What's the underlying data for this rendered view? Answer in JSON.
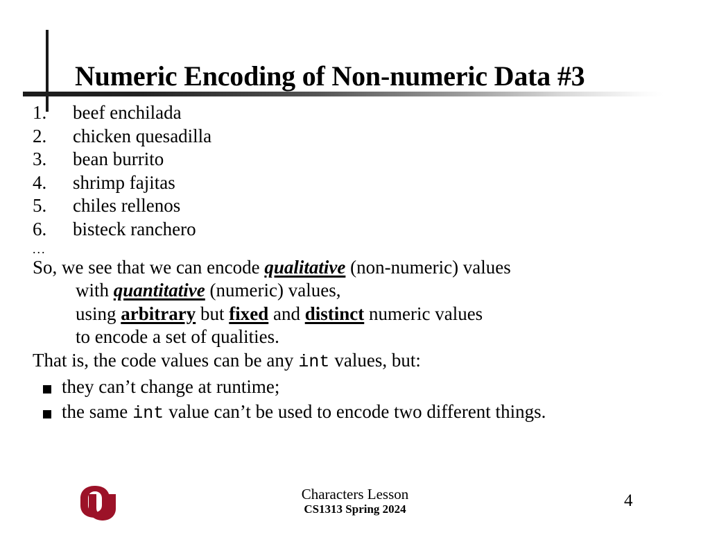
{
  "slide": {
    "title": "Numeric Encoding of Non-numeric Data #3",
    "page_number": "4"
  },
  "food_list": {
    "items": [
      {
        "number": "1.",
        "label": "beef enchilada"
      },
      {
        "number": "2.",
        "label": "chicken quesadilla"
      },
      {
        "number": "3.",
        "label": "bean burrito"
      },
      {
        "number": "4.",
        "label": "shrimp fajitas"
      },
      {
        "number": "5.",
        "label": "chiles rellenos"
      },
      {
        "number": "6.",
        "label": "bisteck ranchero"
      }
    ],
    "continuation": "..."
  },
  "paragraph": {
    "line1_a": "So, we see that we can encode ",
    "line1_emph": "qualitative",
    "line1_b": " (non-numeric) values",
    "line2_a": "with ",
    "line2_emph": "quantitative",
    "line2_b": " (numeric) values,",
    "line3_a": "using ",
    "line3_emph1": "arbitrary",
    "line3_b": " but ",
    "line3_emph2": "fixed",
    "line3_c": " and ",
    "line3_emph3": "distinct",
    "line3_d": " numeric values",
    "line4": "to encode a set of qualities.",
    "line5_a": "That is, the code values can be any",
    "line5_code": "int",
    "line5_b": "values, but:"
  },
  "bullets": {
    "item1": "they can’t change at runtime;",
    "item2_a": "the same",
    "item2_code": "int",
    "item2_b": "value can’t be used to encode two different things."
  },
  "footer": {
    "logo_alt": "University of Oklahoma OU logo",
    "lesson_title": "Characters Lesson",
    "course": "CS1313 Spring 2024"
  },
  "colors": {
    "crimson": "#9C1228",
    "rule_dark": "#1c1c1c",
    "text": "#000000"
  }
}
